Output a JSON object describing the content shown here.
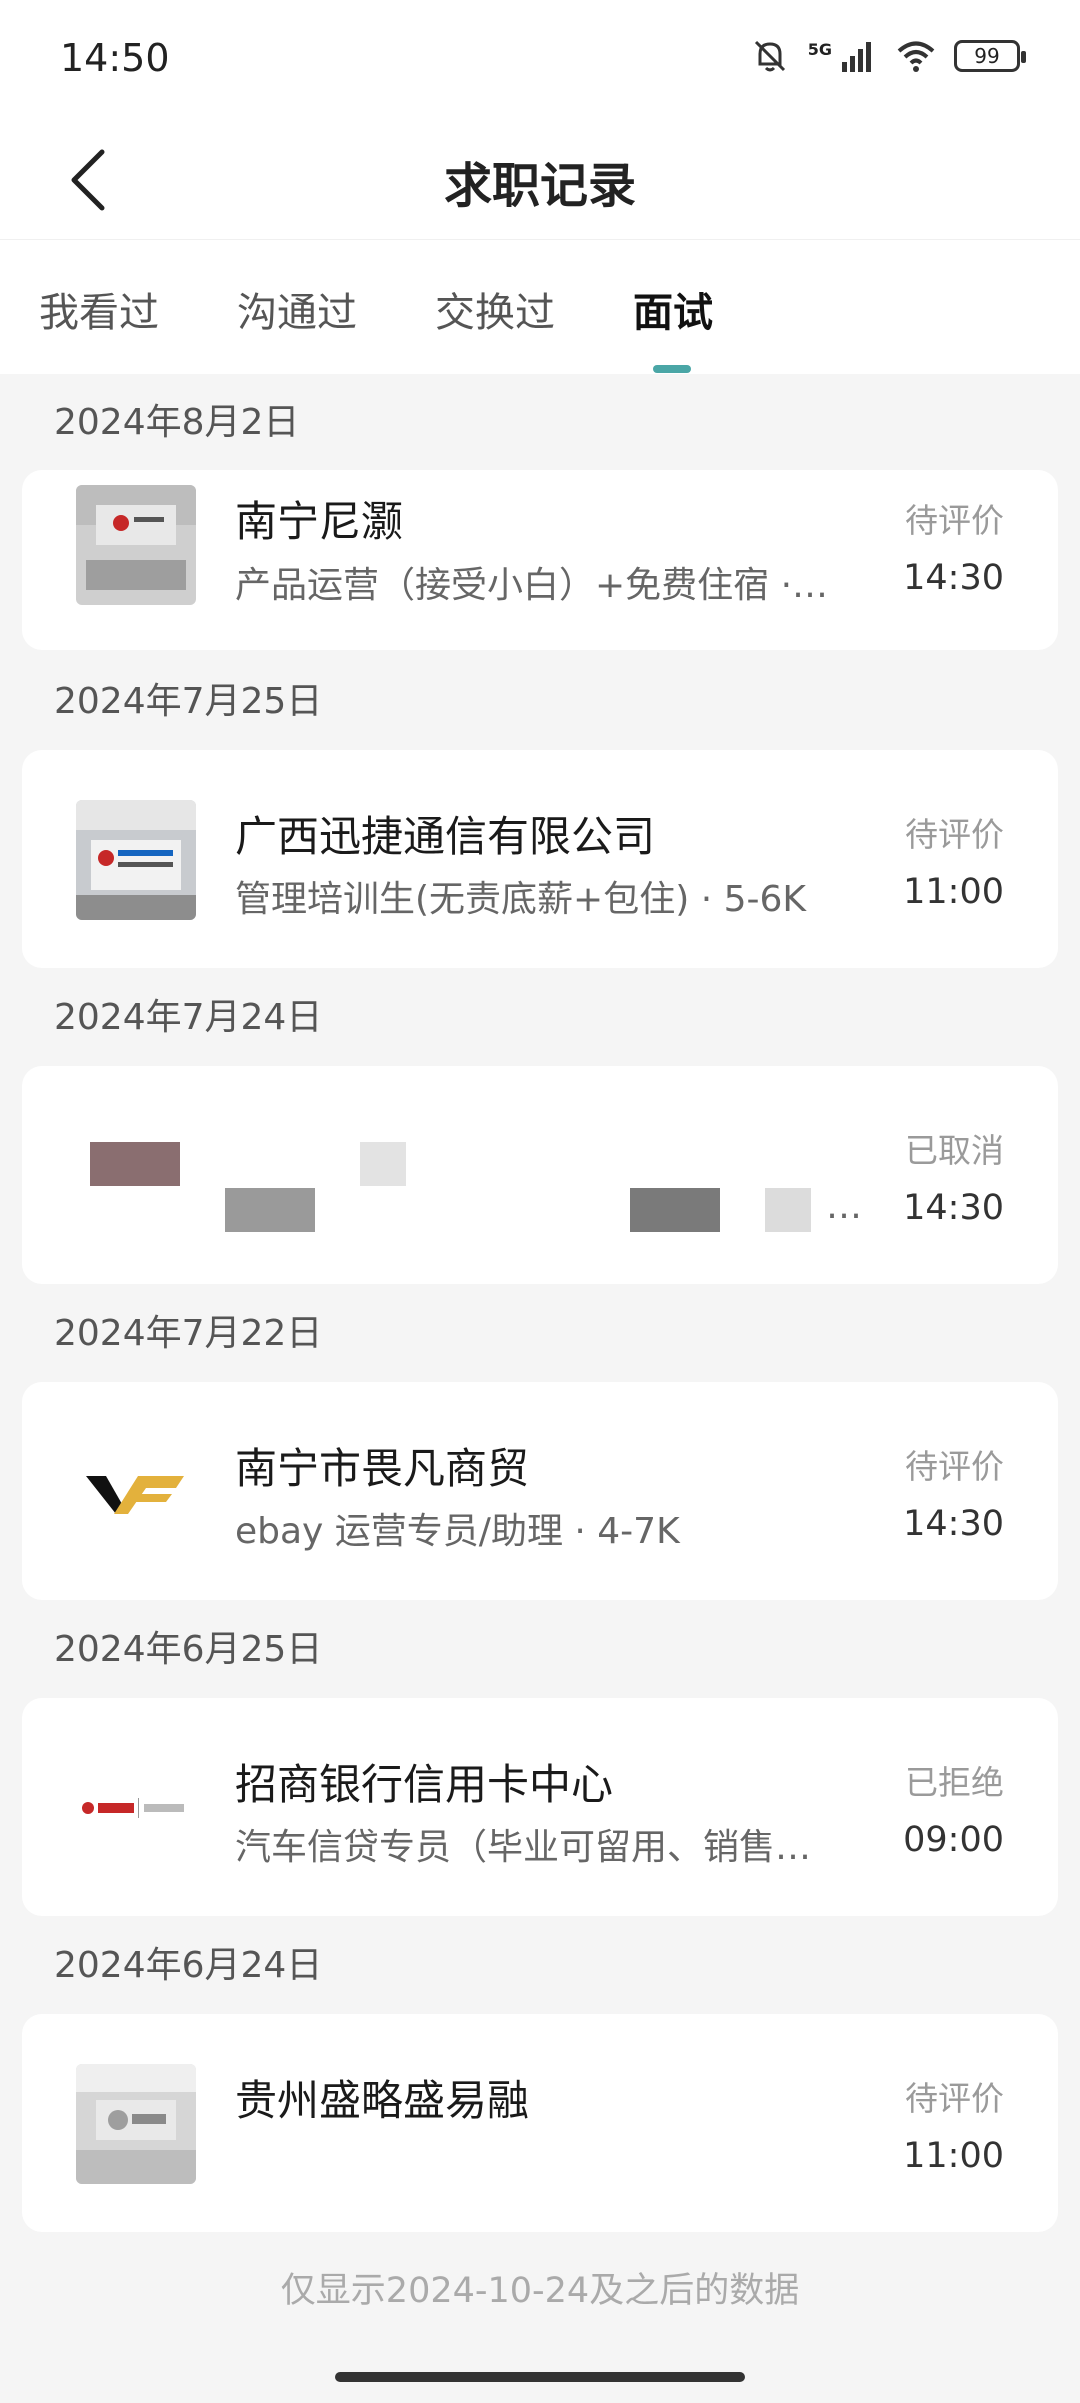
{
  "status_bar": {
    "time": "14:50",
    "network": "5G",
    "battery": "99",
    "icons": [
      "mute-bell-icon",
      "signal-icon",
      "wifi-icon",
      "battery-icon"
    ]
  },
  "header": {
    "title": "求职记录",
    "back_icon": "chevron-left-icon"
  },
  "tabs": [
    {
      "label": "我看过",
      "active": false
    },
    {
      "label": "沟通过",
      "active": false
    },
    {
      "label": "交换过",
      "active": false
    },
    {
      "label": "面试",
      "active": true
    }
  ],
  "accent_color": "#4aa6a6",
  "records": [
    {
      "date": "2024年8月2日",
      "company": "南宁尼灏",
      "job": "产品运营（接受小白）+免费住宿 ·…",
      "status": "待评价",
      "time": "14:30"
    },
    {
      "date": "2024年7月25日",
      "company": "广西迅捷通信有限公司",
      "job": "管理培训生(无责底薪+包住) · 5-6K",
      "status": "待评价",
      "time": "11:00"
    },
    {
      "date": "2024年7月24日",
      "company": "",
      "job": "…",
      "status": "已取消",
      "time": "14:30"
    },
    {
      "date": "2024年7月22日",
      "company": "南宁市畏凡商贸",
      "job": "ebay 运营专员/助理 · 4-7K",
      "status": "待评价",
      "time": "14:30"
    },
    {
      "date": "2024年6月25日",
      "company": "招商银行信用卡中心",
      "job": "汽车信贷专员（毕业可留用、销售…",
      "status": "已拒绝",
      "time": "09:00"
    },
    {
      "date": "2024年6月24日",
      "company": "贵州盛略盛易融",
      "job": "",
      "status": "待评价",
      "time": "11:00"
    }
  ],
  "footer_note": "仅显示2024-10-24及之后的数据"
}
